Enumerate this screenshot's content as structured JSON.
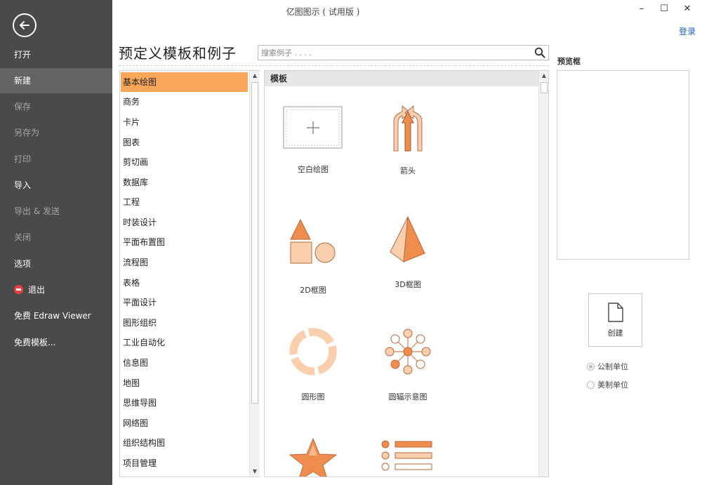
{
  "window": {
    "title": "亿图图示 ( 试用版 )",
    "controls": {
      "minimize": "–",
      "maximize": "☐",
      "close": "✕"
    },
    "login": "登录"
  },
  "sidebar": {
    "back_icon": "back-arrow-icon",
    "items": [
      {
        "label": "打开",
        "state": "normal"
      },
      {
        "label": "新建",
        "state": "active"
      },
      {
        "label": "保存",
        "state": "disabled"
      },
      {
        "label": "另存为",
        "state": "disabled"
      },
      {
        "label": "打印",
        "state": "disabled"
      },
      {
        "label": "导入",
        "state": "normal"
      },
      {
        "label": "导出 & 发送",
        "state": "disabled"
      },
      {
        "label": "关闭",
        "state": "disabled"
      },
      {
        "label": "选项",
        "state": "normal"
      },
      {
        "label": "退出",
        "state": "normal",
        "icon": "exit-icon"
      },
      {
        "label": "免费 Edraw Viewer",
        "state": "normal"
      },
      {
        "label": "免费模板...",
        "state": "normal"
      }
    ]
  },
  "main": {
    "title": "预定义模板和例子",
    "search": {
      "placeholder": "搜索例子 . . . .",
      "value": ""
    },
    "categories": [
      {
        "label": "基本绘图",
        "selected": true
      },
      {
        "label": "商务"
      },
      {
        "label": "卡片"
      },
      {
        "label": "图表"
      },
      {
        "label": "剪切画"
      },
      {
        "label": "数据库"
      },
      {
        "label": "工程"
      },
      {
        "label": "时装设计"
      },
      {
        "label": "平面布置图"
      },
      {
        "label": "流程图"
      },
      {
        "label": "表格"
      },
      {
        "label": "平面设计"
      },
      {
        "label": "图形组织"
      },
      {
        "label": "工业自动化"
      },
      {
        "label": "信息图"
      },
      {
        "label": "地图"
      },
      {
        "label": "思维导图"
      },
      {
        "label": "网络图"
      },
      {
        "label": "组织结构图"
      },
      {
        "label": "项目管理"
      }
    ],
    "templates_header": "模板",
    "templates": [
      {
        "label": "空白绘图",
        "icon": "blank-canvas-icon"
      },
      {
        "label": "箭头",
        "icon": "arrows-icon"
      },
      {
        "label": "2D框图",
        "icon": "2d-shapes-icon"
      },
      {
        "label": "3D框图",
        "icon": "3d-pyramid-icon"
      },
      {
        "label": "圆形图",
        "icon": "circular-diagram-icon"
      },
      {
        "label": "圆辐示意图",
        "icon": "radial-diagram-icon"
      },
      {
        "label": "",
        "icon": "star-icon"
      },
      {
        "label": "",
        "icon": "list-bars-icon"
      }
    ]
  },
  "preview": {
    "label": "预览框",
    "create_label": "创建",
    "units": [
      {
        "label": "公制单位",
        "checked": true
      },
      {
        "label": "美制单位",
        "checked": false
      }
    ]
  },
  "colors": {
    "sidebar_bg": "#4a4a4a",
    "sidebar_active": "#636363",
    "accent_orange": "#f7a757",
    "shape_orange": "#ef8d4e",
    "shape_light": "#f9cfae",
    "link_blue": "#1e62c0"
  }
}
